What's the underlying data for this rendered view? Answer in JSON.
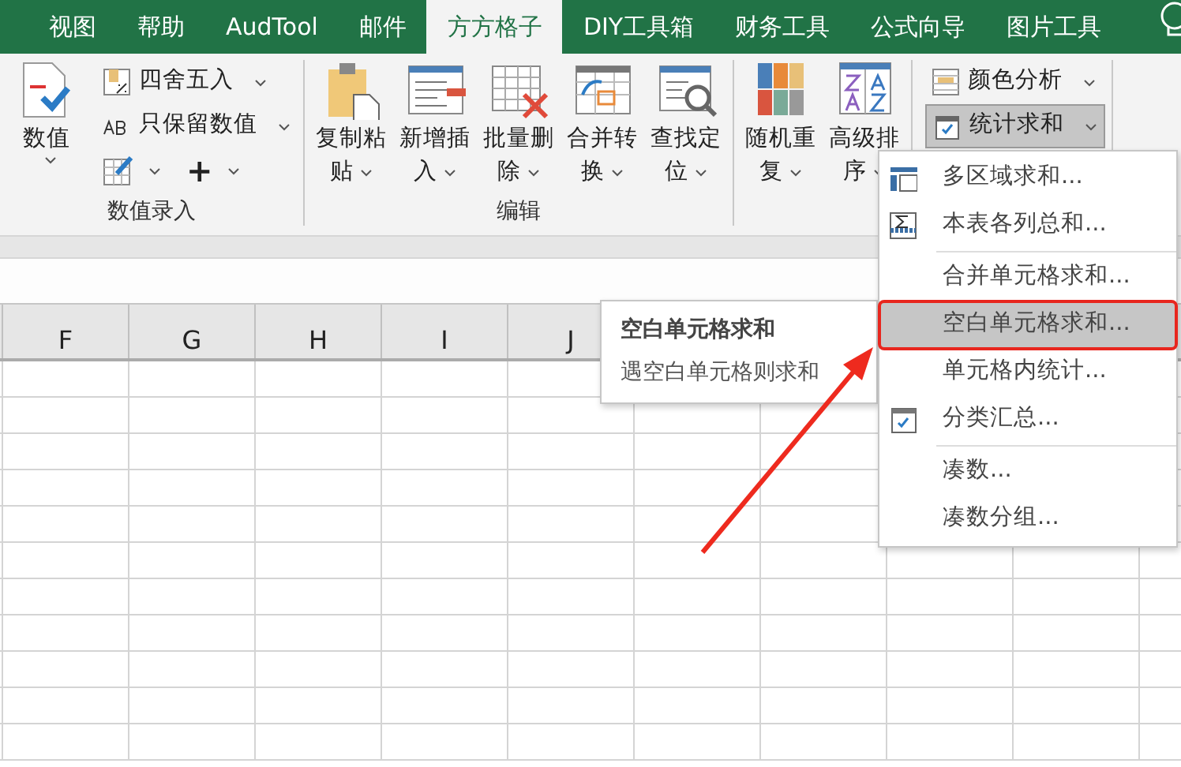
{
  "tabs": [
    {
      "label": "视图",
      "selected": false
    },
    {
      "label": "帮助",
      "selected": false
    },
    {
      "label": "AudTool",
      "selected": false
    },
    {
      "label": "邮件",
      "selected": false
    },
    {
      "label": "方方格子",
      "selected": true
    },
    {
      "label": "DIY工具箱",
      "selected": false
    },
    {
      "label": "财务工具",
      "selected": false
    },
    {
      "label": "公式向导",
      "selected": false
    },
    {
      "label": "图片工具",
      "selected": false
    }
  ],
  "ribbon": {
    "groups": [
      {
        "label": "数值录入",
        "large": [
          {
            "lines": [
              "数值"
            ]
          }
        ],
        "small": [
          {
            "label": "四舍五入"
          },
          {
            "label": "只保留数值"
          }
        ],
        "icon_buttons": [
          {
            "kind": "icon"
          },
          {
            "kind": "glyph",
            "glyph": "+"
          }
        ]
      },
      {
        "label": "编辑",
        "large": [
          {
            "lines": [
              "复制粘",
              "贴"
            ]
          },
          {
            "lines": [
              "新增插",
              "入"
            ]
          },
          {
            "lines": [
              "批量删",
              "除"
            ]
          },
          {
            "lines": [
              "合并转",
              "换"
            ]
          },
          {
            "lines": [
              "查找定",
              "位"
            ]
          }
        ]
      },
      {
        "large": [
          {
            "lines": [
              "随机重",
              "复"
            ]
          },
          {
            "lines": [
              "高级排",
              "序"
            ]
          }
        ]
      },
      {
        "small": [
          {
            "label": "颜色分析",
            "pressed": false
          },
          {
            "label": "统计求和",
            "pressed": true
          }
        ]
      }
    ]
  },
  "sheet": {
    "columns": [
      "F",
      "G",
      "H",
      "I",
      "J"
    ]
  },
  "tooltip": {
    "title": "空白单元格求和",
    "text": "遇空白单元格则求和"
  },
  "menu": [
    {
      "kind": "item",
      "label": "多区域求和...",
      "selected": false
    },
    {
      "kind": "item",
      "label": "本表各列总和...",
      "selected": false
    },
    {
      "kind": "separator"
    },
    {
      "kind": "item",
      "label": "合并单元格求和...",
      "selected": false
    },
    {
      "kind": "item",
      "label": "空白单元格求和...",
      "selected": true
    },
    {
      "kind": "item",
      "label": "单元格内统计...",
      "selected": false
    },
    {
      "kind": "item",
      "label": "分类汇总...",
      "selected": false
    },
    {
      "kind": "separator"
    },
    {
      "kind": "item",
      "label": "凑数...",
      "selected": false
    },
    {
      "kind": "item",
      "label": "凑数分组...",
      "selected": false
    }
  ]
}
